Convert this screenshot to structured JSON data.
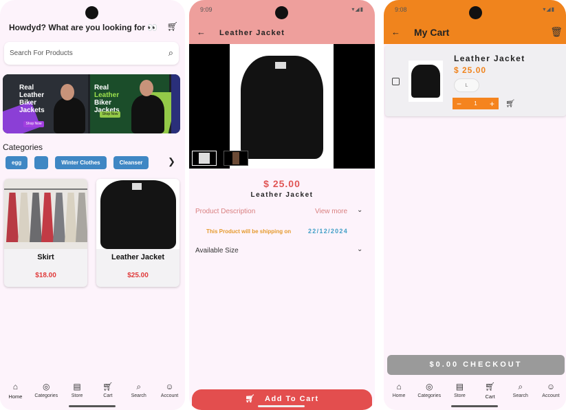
{
  "home": {
    "greeting": "Howdyd? What are you looking for 👀",
    "cart_icon": "cart-icon",
    "search_placeholder": "Search For Products",
    "banner": {
      "panel1_text": [
        "Real",
        "Leather",
        "Biker",
        "Jackets"
      ],
      "panel2_text": [
        "Real",
        "Leather",
        "Biker",
        "Jackets"
      ],
      "shop_label": "Shop Now"
    },
    "categories_title": "Categories",
    "categories": [
      "egg",
      "",
      "Winter Clothes",
      "Cleanser"
    ],
    "products": [
      {
        "name": "Skirt",
        "price": "$18.00"
      },
      {
        "name": "Leather Jacket",
        "price": "$25.00"
      }
    ]
  },
  "nav": {
    "items": [
      {
        "label": "Home",
        "icon": "home-icon"
      },
      {
        "label": "Categories",
        "icon": "compass-icon"
      },
      {
        "label": "Store",
        "icon": "store-icon"
      },
      {
        "label": "Cart",
        "icon": "cart-icon"
      },
      {
        "label": "Search",
        "icon": "search-icon"
      },
      {
        "label": "Account",
        "icon": "person-icon"
      }
    ]
  },
  "detail": {
    "time": "9:09",
    "title": "Leather Jacket",
    "price": "$ 25.00",
    "name": "Leather Jacket",
    "description_label": "Product Description",
    "view_more": "View more",
    "shipping_text": "This Product will be shipping on",
    "shipping_date": "22/12/2024",
    "available_size": "Available Size",
    "add_to_cart": "Add To Cart"
  },
  "cart": {
    "time": "9:08",
    "title": "My Cart",
    "item": {
      "name": "Leather Jacket",
      "price": "$ 25.00",
      "size": "L",
      "qty": "1"
    },
    "checkout": "$0.00 CHECKOUT"
  },
  "colors": {
    "detail_header": "#ee9f9c",
    "cart_header": "#f0841d",
    "chip": "#3f87c4",
    "price_red": "#e03a3a",
    "add_to_cart": "#e34e4e",
    "checkout_disabled": "#9a9a9a"
  }
}
